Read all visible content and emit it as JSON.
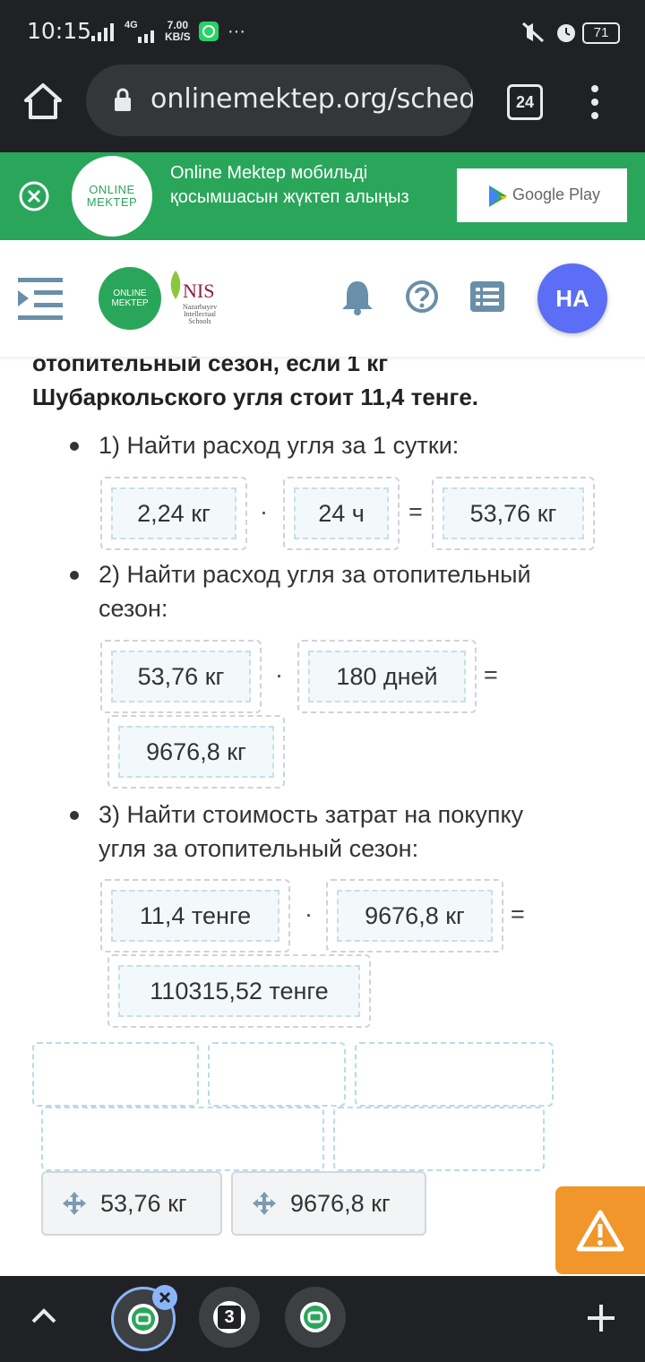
{
  "status_bar": {
    "time": "10:15",
    "network": "4G",
    "speed_value": "7.00",
    "speed_unit": "KB/S",
    "more": "···",
    "battery": "71"
  },
  "browser": {
    "url": "onlinemektep.org/schedule",
    "tabs_count": "24"
  },
  "banner": {
    "logo_line1": "ONLINE",
    "logo_line2": "MEKTEP",
    "text": "Online Mektep мобильді қосымшасын жүктеп алыңыз",
    "store_label": "Google Play"
  },
  "header": {
    "logo_line1": "ONLINE",
    "logo_line2": "MEKTEP",
    "nis_title": "NIS",
    "nis_line1": "Nazarbayev",
    "nis_line2": "Intellectual",
    "nis_line3": "Schools",
    "avatar_initials": "НА"
  },
  "task": {
    "paragraph_line1": "отопительный сезон, если 1 кг",
    "paragraph_line2": "Шубаркольского угля стоит 11,4 тенге.",
    "step1": {
      "title": "1) Найти расход угля за 1 сутки:",
      "a": "2,24 кг",
      "op": "·",
      "b": "24 ч",
      "eq": "=",
      "result": "53,76 кг"
    },
    "step2": {
      "title_line1": "2) Найти расход угля за отопительный",
      "title_line2": "сезон:",
      "a": "53,76 кг",
      "op": "·",
      "b": "180 дней",
      "eq": "=",
      "result": "9676,8 кг"
    },
    "step3": {
      "title_line1": "3) Найти стоимость затрат на покупку",
      "title_line2": "угля за отопительный сезон:",
      "a": "11,4 тенге",
      "op": "·",
      "b": "9676,8 кг",
      "eq": "=",
      "result": "110315,52 тенге"
    },
    "draggables": [
      "53,76 кг",
      "9676,8 кг"
    ]
  },
  "nav": {
    "tab2_label": "3"
  },
  "colors": {
    "brand_green": "#2aa65a",
    "avatar_blue": "#5b6ef5",
    "warning_orange": "#f0962a",
    "icon_blue_gray": "#6a8fa8"
  }
}
